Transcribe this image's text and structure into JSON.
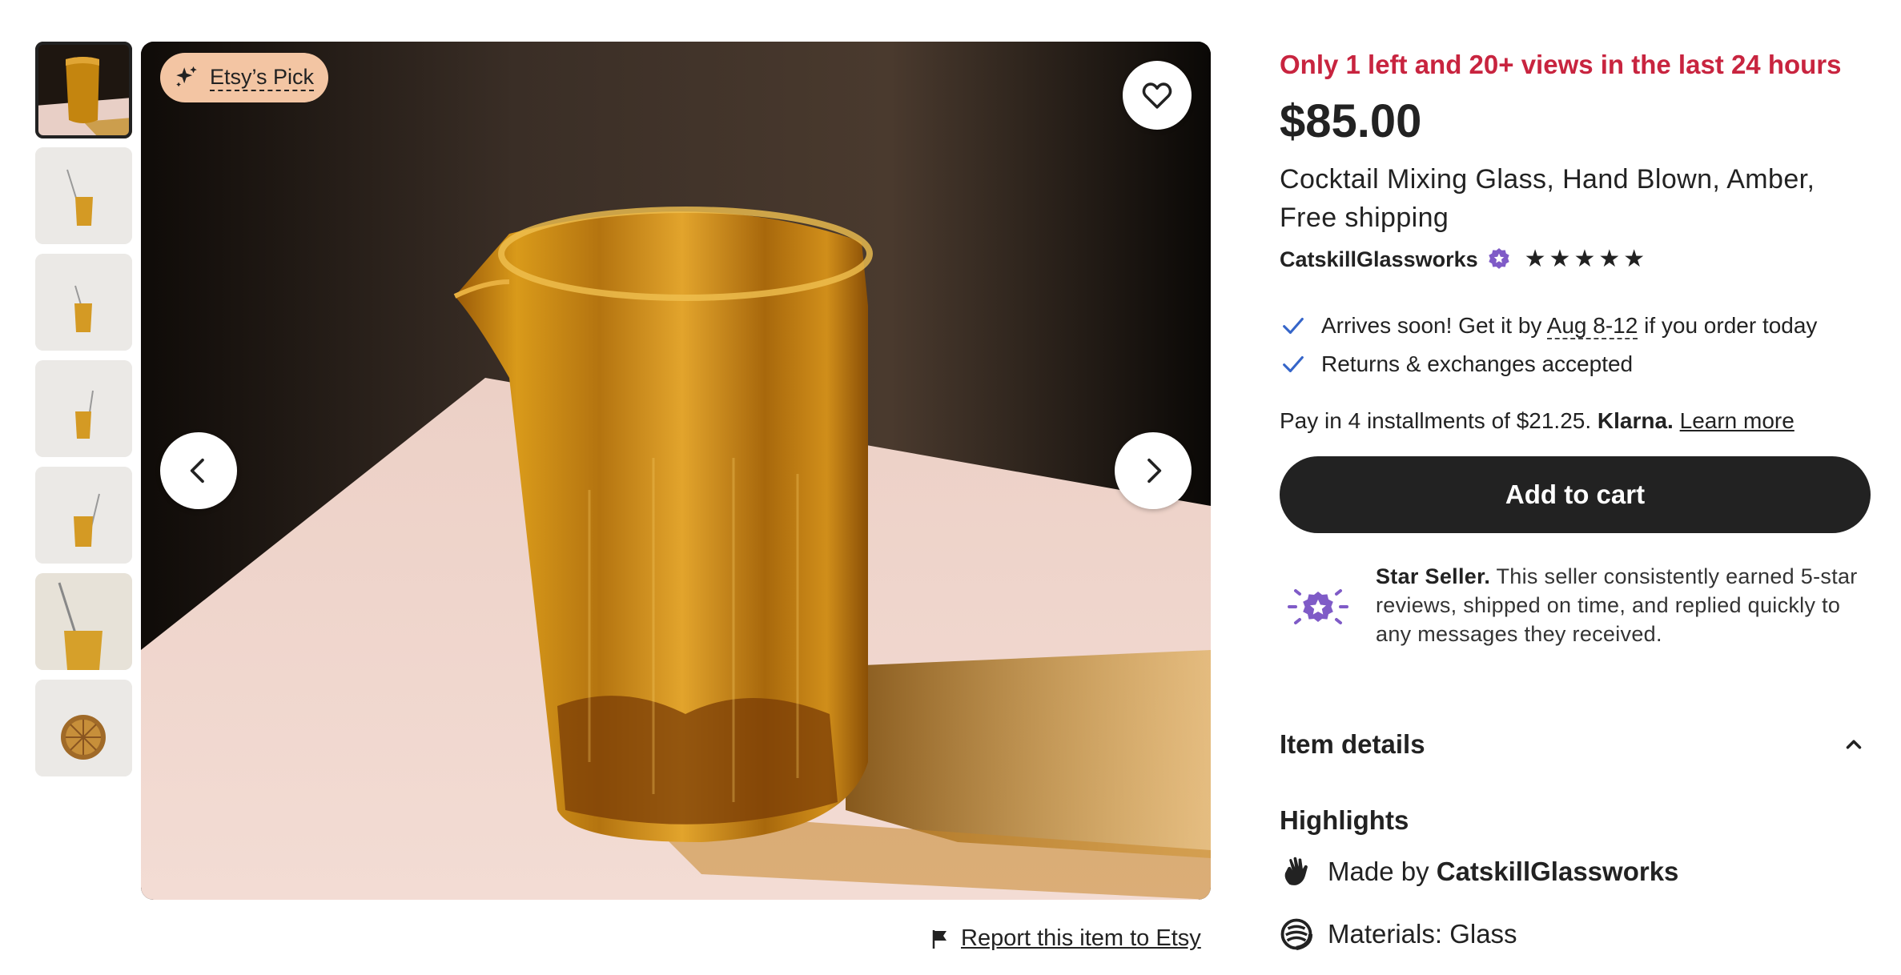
{
  "badge": {
    "label": "Etsy’s Pick"
  },
  "listing": {
    "scarcity": "Only 1 left and 20+ views in the last 24 hours",
    "price": "$85.00",
    "title": "Cocktail Mixing Glass, Hand Blown, Amber, Free shipping"
  },
  "shop": {
    "name": "CatskillGlassworks",
    "rating": 5,
    "stars": [
      "★",
      "★",
      "★",
      "★",
      "★"
    ]
  },
  "delivery": {
    "prefix": "Arrives soon! Get it by ",
    "dates": "Aug 8-12",
    "suffix": " if you order today",
    "returns": "Returns & exchanges accepted"
  },
  "payment": {
    "prefix": "Pay in 4 installments of $21.25. ",
    "provider": "Klarna.",
    "learn_more": "Learn more"
  },
  "cart": {
    "button_label": "Add to cart"
  },
  "star_seller": {
    "title": "Star Seller.",
    "description": " This seller consistently earned 5-star reviews, shipped on time, and replied quickly to any messages they received."
  },
  "details": {
    "heading": "Item details",
    "highlights_heading": "Highlights",
    "made_by_prefix": "Made by ",
    "made_by_shop": "CatskillGlassworks",
    "materials": "Materials: Glass"
  },
  "report": {
    "label": "Report this item to Etsy"
  },
  "colors": {
    "scarcity": "#c8243f",
    "primary_button": "#222222",
    "badge_bg": "#f3c5a3",
    "star_seller_purple": "#7f5bc7"
  }
}
